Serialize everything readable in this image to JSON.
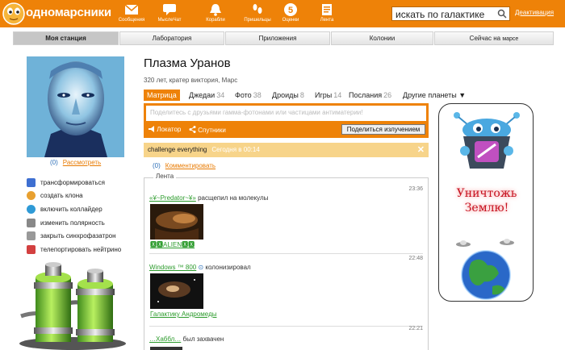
{
  "app": {
    "logo_text": "одномарсники"
  },
  "toolbar": [
    {
      "icon": "envelope-icon",
      "label": "Сообщения"
    },
    {
      "icon": "chat-icon",
      "label": "МыслеЧат"
    },
    {
      "icon": "bell-icon",
      "label": "Корабли"
    },
    {
      "icon": "footprints-icon",
      "label": "Пришельцы"
    },
    {
      "icon": "ratings-icon",
      "label": "Оценки",
      "badge": "5"
    },
    {
      "icon": "feed-icon",
      "label": "Лента"
    }
  ],
  "search": {
    "value": "искать по галактике"
  },
  "logout_label": "Деактивация",
  "nav": {
    "tabs": [
      "Моя станция",
      "Лаборатория",
      "Приложения",
      "Колонии"
    ],
    "now_on_label": "Сейчас на",
    "now_on_value": "марсе"
  },
  "profile": {
    "photo_count": "(0)",
    "view_link": "Рассмотреть",
    "name": "Плазма Уранов",
    "subinfo": "320 лет, кратер виктория, Марс",
    "actions": [
      {
        "icon": "transform-icon",
        "label": "трансформироваться"
      },
      {
        "icon": "clone-icon",
        "label": "создать клона"
      },
      {
        "icon": "collider-icon",
        "label": "включить коллайдер"
      },
      {
        "icon": "polarity-icon",
        "label": "изменить полярность"
      },
      {
        "icon": "lock-icon",
        "label": "закрыть синхрофазатрон"
      },
      {
        "icon": "teleport-icon",
        "label": "телепортировать нейтрино"
      }
    ]
  },
  "tabs": [
    {
      "label": "Матрица",
      "count": ""
    },
    {
      "label": "Джедаи",
      "count": "34"
    },
    {
      "label": "Фото",
      "count": "38"
    },
    {
      "label": "Дроиды",
      "count": "8"
    },
    {
      "label": "Игры",
      "count": "14"
    },
    {
      "label": "Послания",
      "count": "26"
    },
    {
      "label": "Другие планеты ▼",
      "count": ""
    }
  ],
  "compose": {
    "placeholder": "Поделитесь с друзьями гамма-фотонами или частицами антиматерии!",
    "locator": "Локатор",
    "sputnik": "Спутники",
    "share_button": "Поделиться излучением"
  },
  "status": {
    "text": "challenge everything",
    "time": "Сегодня в 00:14",
    "close": "✕"
  },
  "comments": {
    "count": "(0)",
    "link": "Комментировать"
  },
  "feed": {
    "title": "Лента",
    "items": [
      {
        "time": "23:36",
        "user": "«¥~Predator~¥»",
        "action": "расщепил на молекулы",
        "caption": "🆇🆇ALIEN🆇🆇"
      },
      {
        "time": "22:48",
        "user": "Windows ™ 800",
        "action": "колонизировал",
        "caption": "Галактику Андромеды"
      },
      {
        "time": "22:21",
        "user": "…Хаббл…",
        "action": "был захвачен",
        "caption": ""
      }
    ]
  },
  "ad": {
    "line1": "Уничтожь",
    "line2": "Землю!"
  },
  "colors": {
    "brand": "#ee8208",
    "link_blue": "#2c6fb8",
    "link_green": "#2c9b2c",
    "ad_red": "#c7111f"
  }
}
